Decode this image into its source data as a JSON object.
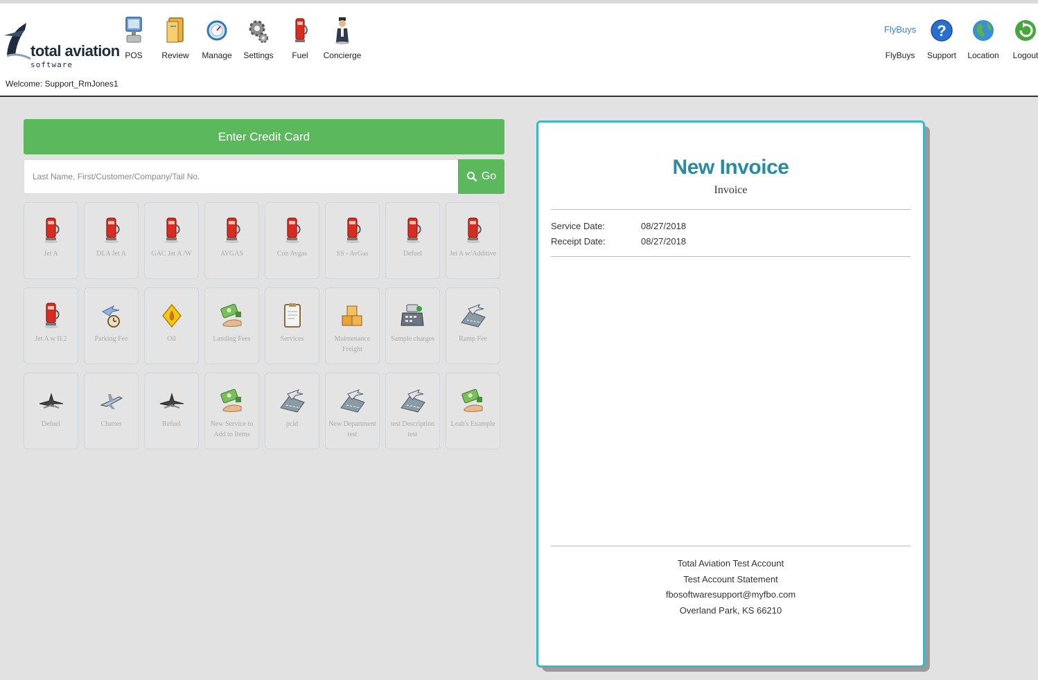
{
  "header": {
    "logo_text": "total aviation",
    "logo_sub": "software",
    "welcome": "Welcome: Support_RmJones1",
    "nav": [
      {
        "label": "POS",
        "icon": "pos-terminal-icon"
      },
      {
        "label": "Review",
        "icon": "folder-icon"
      },
      {
        "label": "Manage",
        "icon": "dial-icon"
      },
      {
        "label": "Settings",
        "icon": "gears-icon"
      },
      {
        "label": "Fuel",
        "icon": "fuel-pump-icon"
      },
      {
        "label": "Concierge",
        "icon": "concierge-icon"
      }
    ],
    "right_nav": [
      {
        "label": "FlyBuys",
        "icon": "flybuys-logo-icon",
        "logo_text": "FlyBuys"
      },
      {
        "label": "Support",
        "icon": "help-icon"
      },
      {
        "label": "Location",
        "icon": "globe-icon"
      },
      {
        "label": "Logout",
        "icon": "logout-icon"
      }
    ]
  },
  "pos": {
    "credit_card_label": "Enter Credit Card",
    "search_placeholder": "Last Name, First/Customer/Company/Tail No.",
    "go_label": "Go",
    "tiles": [
      {
        "label": "Jet A",
        "icon": "fuel-pump-icon"
      },
      {
        "label": "DLA Jet A",
        "icon": "fuel-pump-icon"
      },
      {
        "label": "GAC Jet A /W",
        "icon": "fuel-pump-icon"
      },
      {
        "label": "AVGAS",
        "icon": "fuel-pump-icon"
      },
      {
        "label": "Con Avgas",
        "icon": "fuel-pump-icon"
      },
      {
        "label": "SS - AvGas",
        "icon": "fuel-pump-icon"
      },
      {
        "label": "Defuel",
        "icon": "fuel-pump-icon"
      },
      {
        "label": "Jet A w/Additive",
        "icon": "fuel-pump-icon"
      },
      {
        "label": "Jet A w II.2",
        "icon": "fuel-pump-icon"
      },
      {
        "label": "Parking Fee",
        "icon": "parking-icon"
      },
      {
        "label": "Oil",
        "icon": "oil-icon"
      },
      {
        "label": "Landing Fees",
        "icon": "money-hand-icon"
      },
      {
        "label": "Services",
        "icon": "clipboard-icon"
      },
      {
        "label": "Maintenance Freight",
        "icon": "boxes-icon"
      },
      {
        "label": "Sample charges",
        "icon": "cash-register-icon"
      },
      {
        "label": "Ramp Fee",
        "icon": "runway-plane-icon"
      },
      {
        "label": "Defuel",
        "icon": "plane-front-icon"
      },
      {
        "label": "Charter",
        "icon": "jet-icon"
      },
      {
        "label": "Refuel",
        "icon": "plane-front-icon"
      },
      {
        "label": "New Service to Add to Items",
        "icon": "money-hand-icon"
      },
      {
        "label": "pcid",
        "icon": "runway-plane-icon"
      },
      {
        "label": "New Department test",
        "icon": "runway-plane-icon"
      },
      {
        "label": "test Description test",
        "icon": "runway-plane-icon"
      },
      {
        "label": "Leah's Example",
        "icon": "money-hand-icon"
      }
    ]
  },
  "invoice": {
    "title": "New Invoice",
    "subtitle": "Invoice",
    "service_date_label": "Service Date:",
    "service_date": "08/27/2018",
    "receipt_date_label": "Receipt Date:",
    "receipt_date": "08/27/2018",
    "footer": [
      "Total Aviation Test Account",
      "Test Account Statement",
      "fbosoftwaresupport@myfbo.com",
      "Overland Park, KS 66210"
    ]
  },
  "colors": {
    "accent_green": "#5cb85c",
    "invoice_border": "#3fb5c8",
    "invoice_title": "#2a8aa0"
  }
}
